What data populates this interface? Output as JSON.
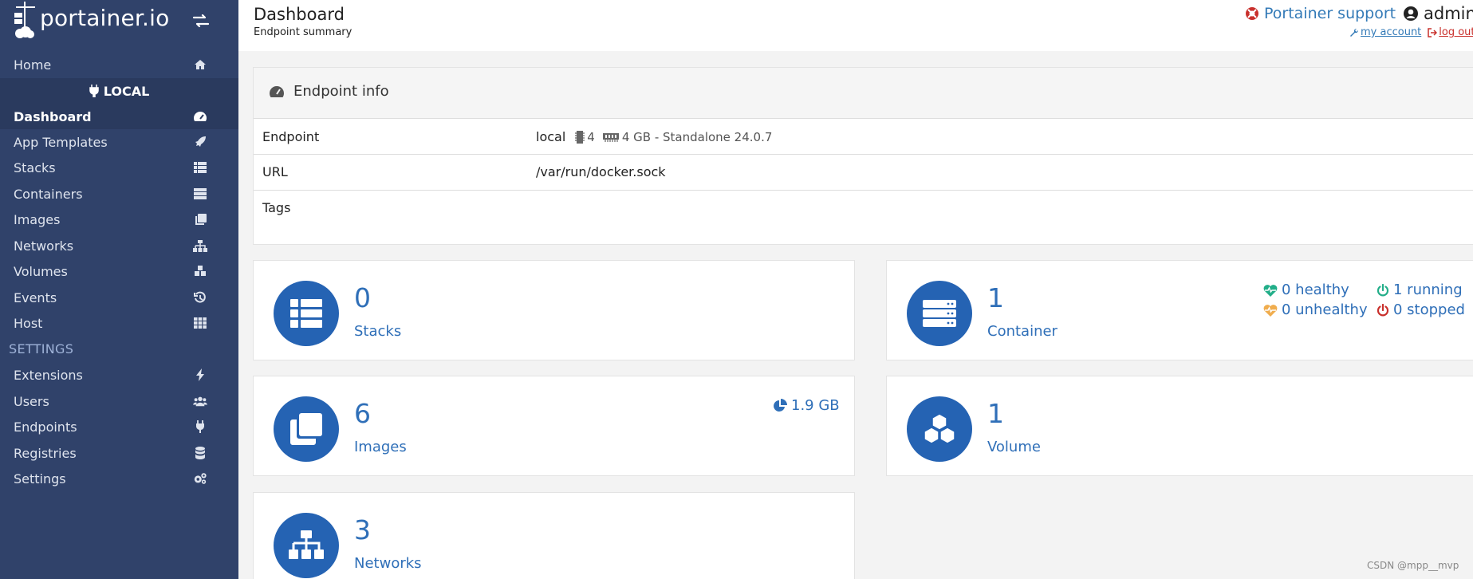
{
  "brand": {
    "name": "portainer.io"
  },
  "sidebar": {
    "home": "Home",
    "endpoint": "LOCAL",
    "items": [
      {
        "label": "Dashboard",
        "icon": "tachometer-icon"
      },
      {
        "label": "App Templates",
        "icon": "rocket-icon"
      },
      {
        "label": "Stacks",
        "icon": "th-list-icon"
      },
      {
        "label": "Containers",
        "icon": "server-icon"
      },
      {
        "label": "Images",
        "icon": "clone-icon"
      },
      {
        "label": "Networks",
        "icon": "sitemap-icon"
      },
      {
        "label": "Volumes",
        "icon": "cubes-icon"
      },
      {
        "label": "Events",
        "icon": "history-icon"
      },
      {
        "label": "Host",
        "icon": "th-icon"
      }
    ],
    "settings_title": "SETTINGS",
    "settings_items": [
      {
        "label": "Extensions",
        "icon": "bolt-icon"
      },
      {
        "label": "Users",
        "icon": "users-icon"
      },
      {
        "label": "Endpoints",
        "icon": "plug-icon"
      },
      {
        "label": "Registries",
        "icon": "database-icon"
      },
      {
        "label": "Settings",
        "icon": "cogs-icon"
      }
    ]
  },
  "header": {
    "title": "Dashboard",
    "subtitle": "Endpoint summary",
    "support": "Portainer support",
    "user": "admin",
    "my_account": "my account",
    "log_out": "log out"
  },
  "endpoint_info": {
    "title": "Endpoint info",
    "rows": {
      "endpoint_label": "Endpoint",
      "endpoint_name": "local",
      "cpu": "4",
      "memory": "4 GB - Standalone 24.0.7",
      "url_label": "URL",
      "url": "/var/run/docker.sock",
      "tags_label": "Tags"
    }
  },
  "widgets": {
    "stacks": {
      "count": "0",
      "label": "Stacks"
    },
    "containers": {
      "count": "1",
      "label": "Container",
      "healthy": "0 healthy",
      "unhealthy": "0 unhealthy",
      "running": "1 running",
      "stopped": "0 stopped"
    },
    "images": {
      "count": "6",
      "label": "Images",
      "size": "1.9 GB"
    },
    "volumes": {
      "count": "1",
      "label": "Volume"
    },
    "networks": {
      "count": "3",
      "label": "Networks"
    }
  },
  "colors": {
    "sidebar": "#30426a",
    "accent": "#2563b3",
    "link": "#337ab7",
    "healthy": "#23ae89",
    "unhealthy": "#f0ad4e",
    "stopped": "#c9302c"
  },
  "watermark": "CSDN @mpp__mvp"
}
